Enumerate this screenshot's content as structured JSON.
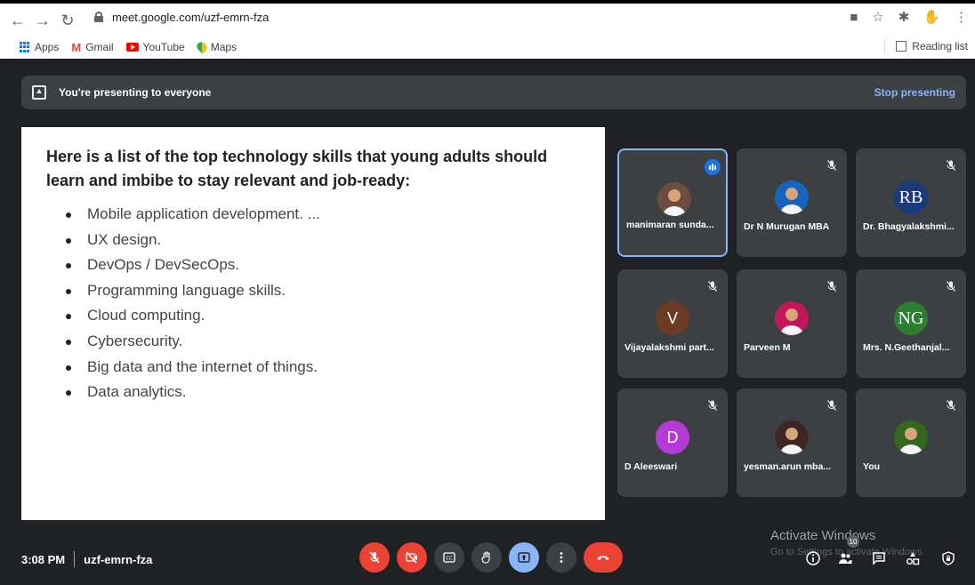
{
  "browser": {
    "url": "meet.google.com/uzf-emrn-fza",
    "bookmarks": [
      {
        "label": "Apps",
        "icon": "apps-grid-icon"
      },
      {
        "label": "Gmail",
        "icon": "gmail-icon"
      },
      {
        "label": "YouTube",
        "icon": "youtube-icon"
      },
      {
        "label": "Maps",
        "icon": "maps-icon"
      }
    ],
    "reading_list": "Reading list"
  },
  "presenting": {
    "message": "You're presenting to everyone",
    "stop_label": "Stop presenting"
  },
  "slide": {
    "title": "Here is a list of the top technology skills that young adults should learn and imbibe to stay relevant and job-ready:",
    "bullets": [
      "Mobile application development. ...",
      "UX design.",
      "DevOps / DevSecOps.",
      "Programming language skills.",
      "Cloud computing.",
      "Cybersecurity.",
      "Big data and the internet of things.",
      "Data analytics."
    ]
  },
  "participants": [
    {
      "name": "manimaran sunda...",
      "avatar": "photo",
      "color": "#6d4c41",
      "speaking": true
    },
    {
      "name": "Dr N Murugan MBA",
      "avatar": "photo",
      "color": "#1565c0"
    },
    {
      "name": "Dr. Bhagyalakshmi...",
      "avatar": "RB",
      "color": "#1a3a7a"
    },
    {
      "name": "Vijayalakshmi part...",
      "avatar": "V",
      "color": "#6d3b24"
    },
    {
      "name": "Parveen M",
      "avatar": "photo",
      "color": "#c2185b"
    },
    {
      "name": "Mrs. N.Geethanjal...",
      "avatar": "NG",
      "color": "#2e7d32"
    },
    {
      "name": "D Aleeswari",
      "avatar": "D",
      "color": "#b43bd6"
    },
    {
      "name": "yesman.arun mba...",
      "avatar": "photo",
      "color": "#3e2723"
    },
    {
      "name": "You",
      "avatar": "photo",
      "color": "#33691e"
    }
  ],
  "meeting": {
    "time": "3:08 PM",
    "code": "uzf-emrn-fza",
    "participant_count": "10"
  },
  "watermark": {
    "line1": "Activate Windows",
    "line2": "Go to Settings to activate Windows."
  }
}
